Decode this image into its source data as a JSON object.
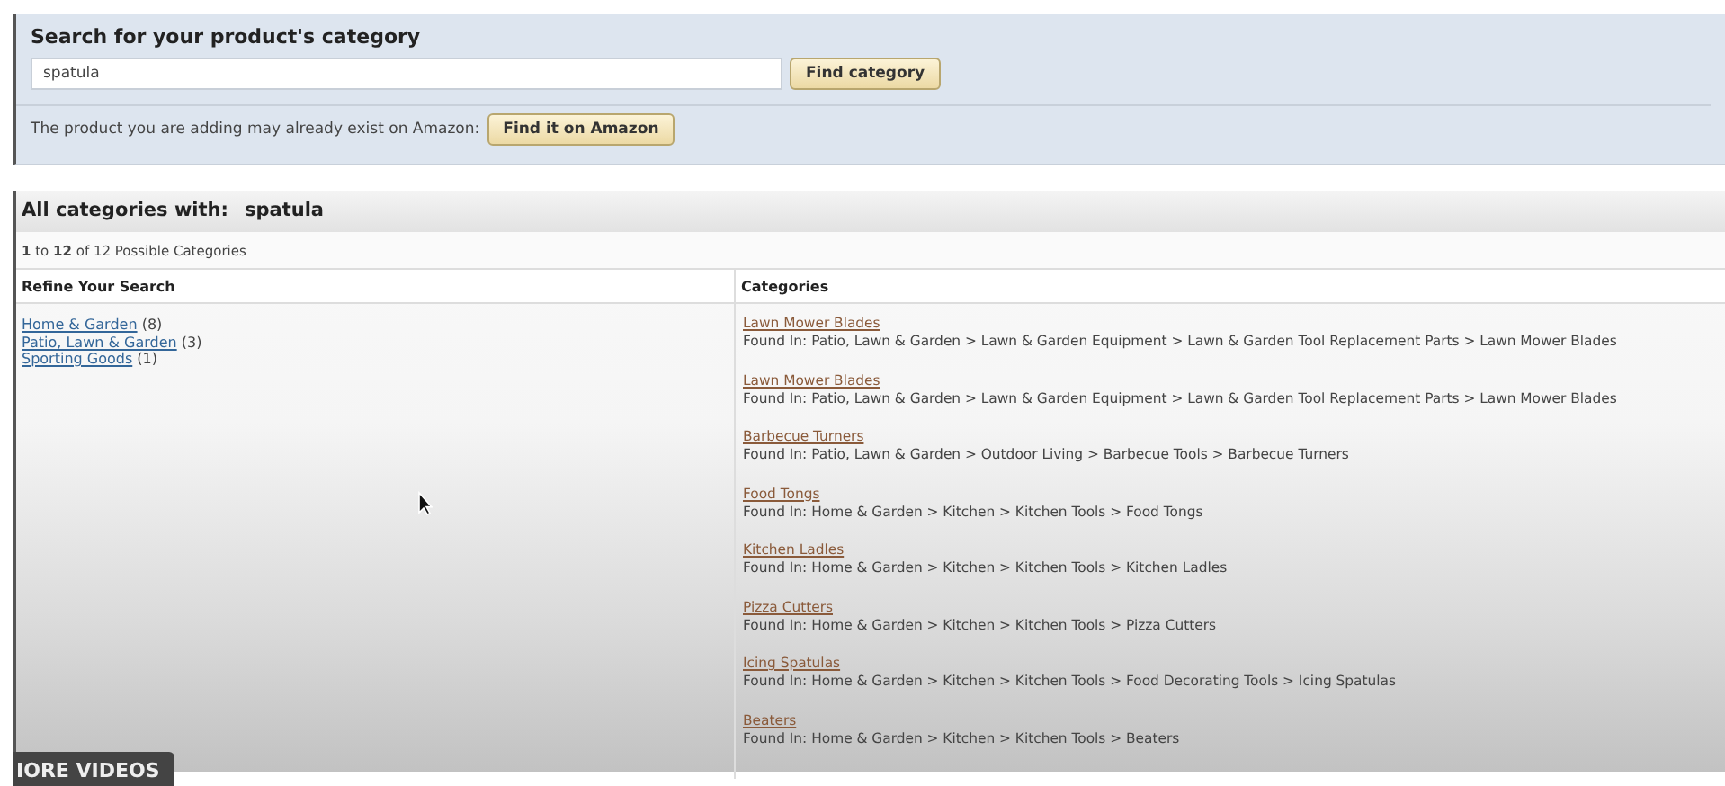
{
  "search_panel": {
    "title": "Search for your product's category",
    "search_value": "spatula",
    "find_button": "Find category",
    "exist_note": "The product you are adding may already exist on Amazon:",
    "amazon_button": "Find it on Amazon"
  },
  "results": {
    "heading_label": "All categories with:",
    "heading_term": "spatula",
    "count": "**1** to **12** of 12 Possible Categories",
    "refine": {
      "title": "Refine Your Search",
      "items": [
        {
          "label": "Home & Garden",
          "count": "(8)"
        },
        {
          "label": "Patio, Lawn & Garden",
          "count": "(3)"
        },
        {
          "label": "Sporting Goods",
          "count": "(1)"
        }
      ]
    },
    "categories": {
      "title": "Categories",
      "items": [
        {
          "name": "Lawn Mower Blades",
          "path": "Found In: Patio, Lawn & Garden > Lawn & Garden Equipment > Lawn & Garden Tool Replacement Parts > Lawn Mower Blades"
        },
        {
          "name": "Lawn Mower Blades",
          "path": "Found In: Patio, Lawn & Garden > Lawn & Garden Equipment > Lawn & Garden Tool Replacement Parts > Lawn Mower Blades"
        },
        {
          "name": "Barbecue Turners",
          "path": "Found In: Patio, Lawn & Garden > Outdoor Living > Barbecue Tools > Barbecue Turners"
        },
        {
          "name": "Food Tongs",
          "path": "Found In: Home & Garden > Kitchen > Kitchen Tools > Food Tongs"
        },
        {
          "name": "Kitchen Ladles",
          "path": "Found In: Home & Garden > Kitchen > Kitchen Tools > Kitchen Ladles"
        },
        {
          "name": "Pizza Cutters",
          "path": "Found In: Home & Garden > Kitchen > Kitchen Tools > Pizza Cutters"
        },
        {
          "name": "Icing Spatulas",
          "path": "Found In: Home & Garden > Kitchen > Kitchen Tools > Food Decorating Tools > Icing Spatulas"
        },
        {
          "name": "Beaters",
          "path": "Found In: Home & Garden > Kitchen > Kitchen Tools > Beaters"
        }
      ]
    }
  },
  "video_overlay": {
    "label": "IORE VIDEOS"
  }
}
